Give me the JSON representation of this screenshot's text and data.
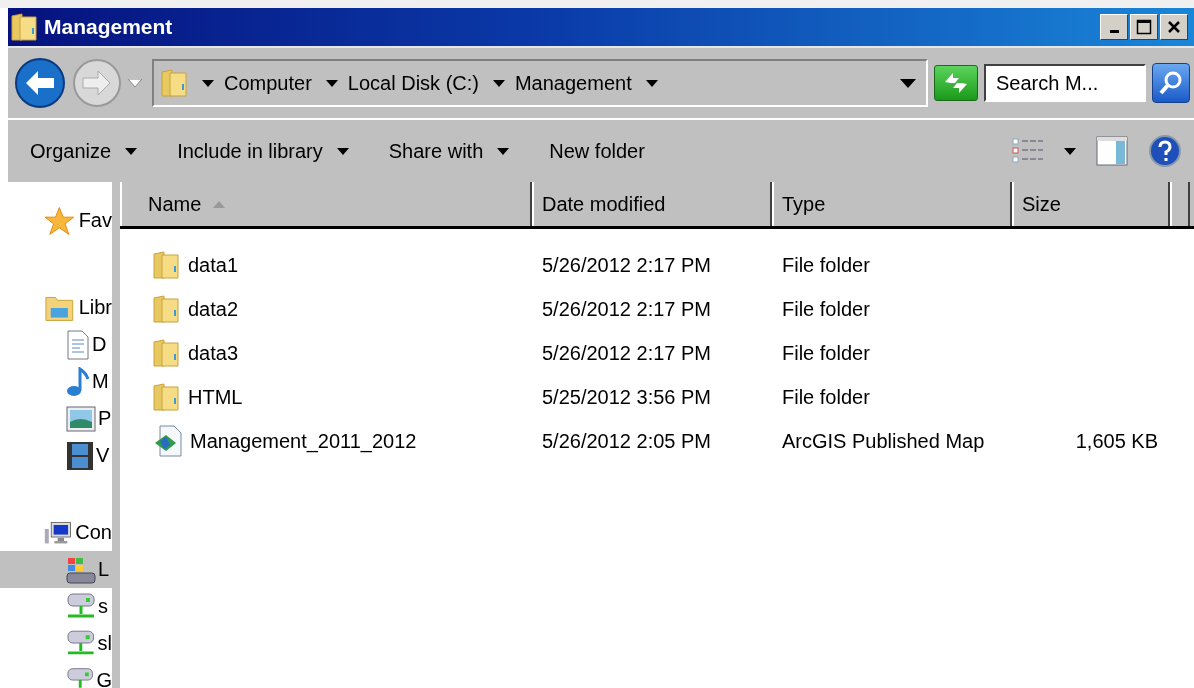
{
  "window": {
    "title": "Management"
  },
  "address_bar": {
    "crumbs": [
      "Computer",
      "Local Disk (C:)",
      "Management"
    ]
  },
  "search": {
    "placeholder": "Search M..."
  },
  "toolbar": {
    "items": [
      {
        "label": "Organize",
        "dropdown": true
      },
      {
        "label": "Include in library",
        "dropdown": true
      },
      {
        "label": "Share with",
        "dropdown": true
      },
      {
        "label": "New folder",
        "dropdown": false
      }
    ]
  },
  "nav_pane": {
    "items": [
      {
        "label": "Fav",
        "kind": "favorites",
        "selected": false
      },
      {
        "label": "Libr",
        "kind": "libraries",
        "selected": false,
        "children": [
          {
            "label": "D",
            "kind": "documents",
            "selected": false
          },
          {
            "label": "M",
            "kind": "music",
            "selected": false
          },
          {
            "label": "P",
            "kind": "pictures",
            "selected": false
          },
          {
            "label": "V",
            "kind": "videos",
            "selected": false
          }
        ]
      },
      {
        "label": "Con",
        "kind": "computer",
        "selected": false,
        "children": [
          {
            "label": "L",
            "kind": "disk",
            "selected": true
          },
          {
            "label": "s",
            "kind": "network",
            "selected": false
          },
          {
            "label": "sl",
            "kind": "network",
            "selected": false
          },
          {
            "label": "G",
            "kind": "network",
            "selected": false
          }
        ]
      }
    ]
  },
  "table": {
    "columns": [
      {
        "label": "Name",
        "sorted": true
      },
      {
        "label": "Date modified",
        "sorted": false
      },
      {
        "label": "Type",
        "sorted": false
      },
      {
        "label": "Size",
        "sorted": false
      }
    ],
    "rows": [
      {
        "kind": "folder",
        "name": "data1",
        "date": "5/26/2012 2:17 PM",
        "type": "File folder"
      },
      {
        "kind": "folder",
        "name": "data2",
        "date": "5/26/2012 2:17 PM",
        "type": "File folder"
      },
      {
        "kind": "folder",
        "name": "data3",
        "date": "5/26/2012 2:17 PM",
        "type": "File folder"
      },
      {
        "kind": "folder",
        "name": "HTML",
        "date": "5/25/2012 3:56 PM",
        "type": "File folder"
      },
      {
        "kind": "map",
        "name": "Management_2011_2012",
        "date": "5/26/2012 2:05 PM",
        "type": "ArcGIS Published Map",
        "size": "1,605 KB"
      }
    ]
  }
}
